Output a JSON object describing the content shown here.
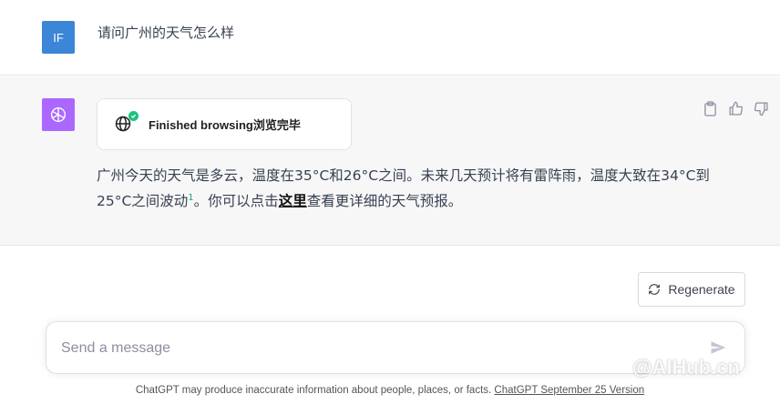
{
  "colors": {
    "user_avatar_bg": "#3b86d6",
    "bot_avatar_bg": "#ab68ff",
    "check_green": "#19c37d",
    "citation_green": "#19a37d"
  },
  "user_message": {
    "avatar_initials": "IF",
    "text": "请问广州的天气怎么样"
  },
  "assistant_message": {
    "avatar_icon": "openai-logo-icon",
    "browsing_status": "Finished browsing浏览完毕",
    "answer_part1": "广州今天的天气是多云，温度在35°C和26°C之间。未来几天预计将有雷阵雨，温度大致在34°C到25°C之间波动",
    "citation": "1",
    "answer_part2": "。你可以点击",
    "link_text": "这里",
    "answer_part3": "查看更详细的天气预报。",
    "actions": [
      "clipboard-icon",
      "thumbs-up-icon",
      "thumbs-down-icon"
    ]
  },
  "regenerate": {
    "label": "Regenerate"
  },
  "composer": {
    "placeholder": "Send a message"
  },
  "footer": {
    "text": "ChatGPT may produce inaccurate information about people, places, or facts. ",
    "link": "ChatGPT September 25 Version"
  },
  "watermark": "@AIHub.cn"
}
